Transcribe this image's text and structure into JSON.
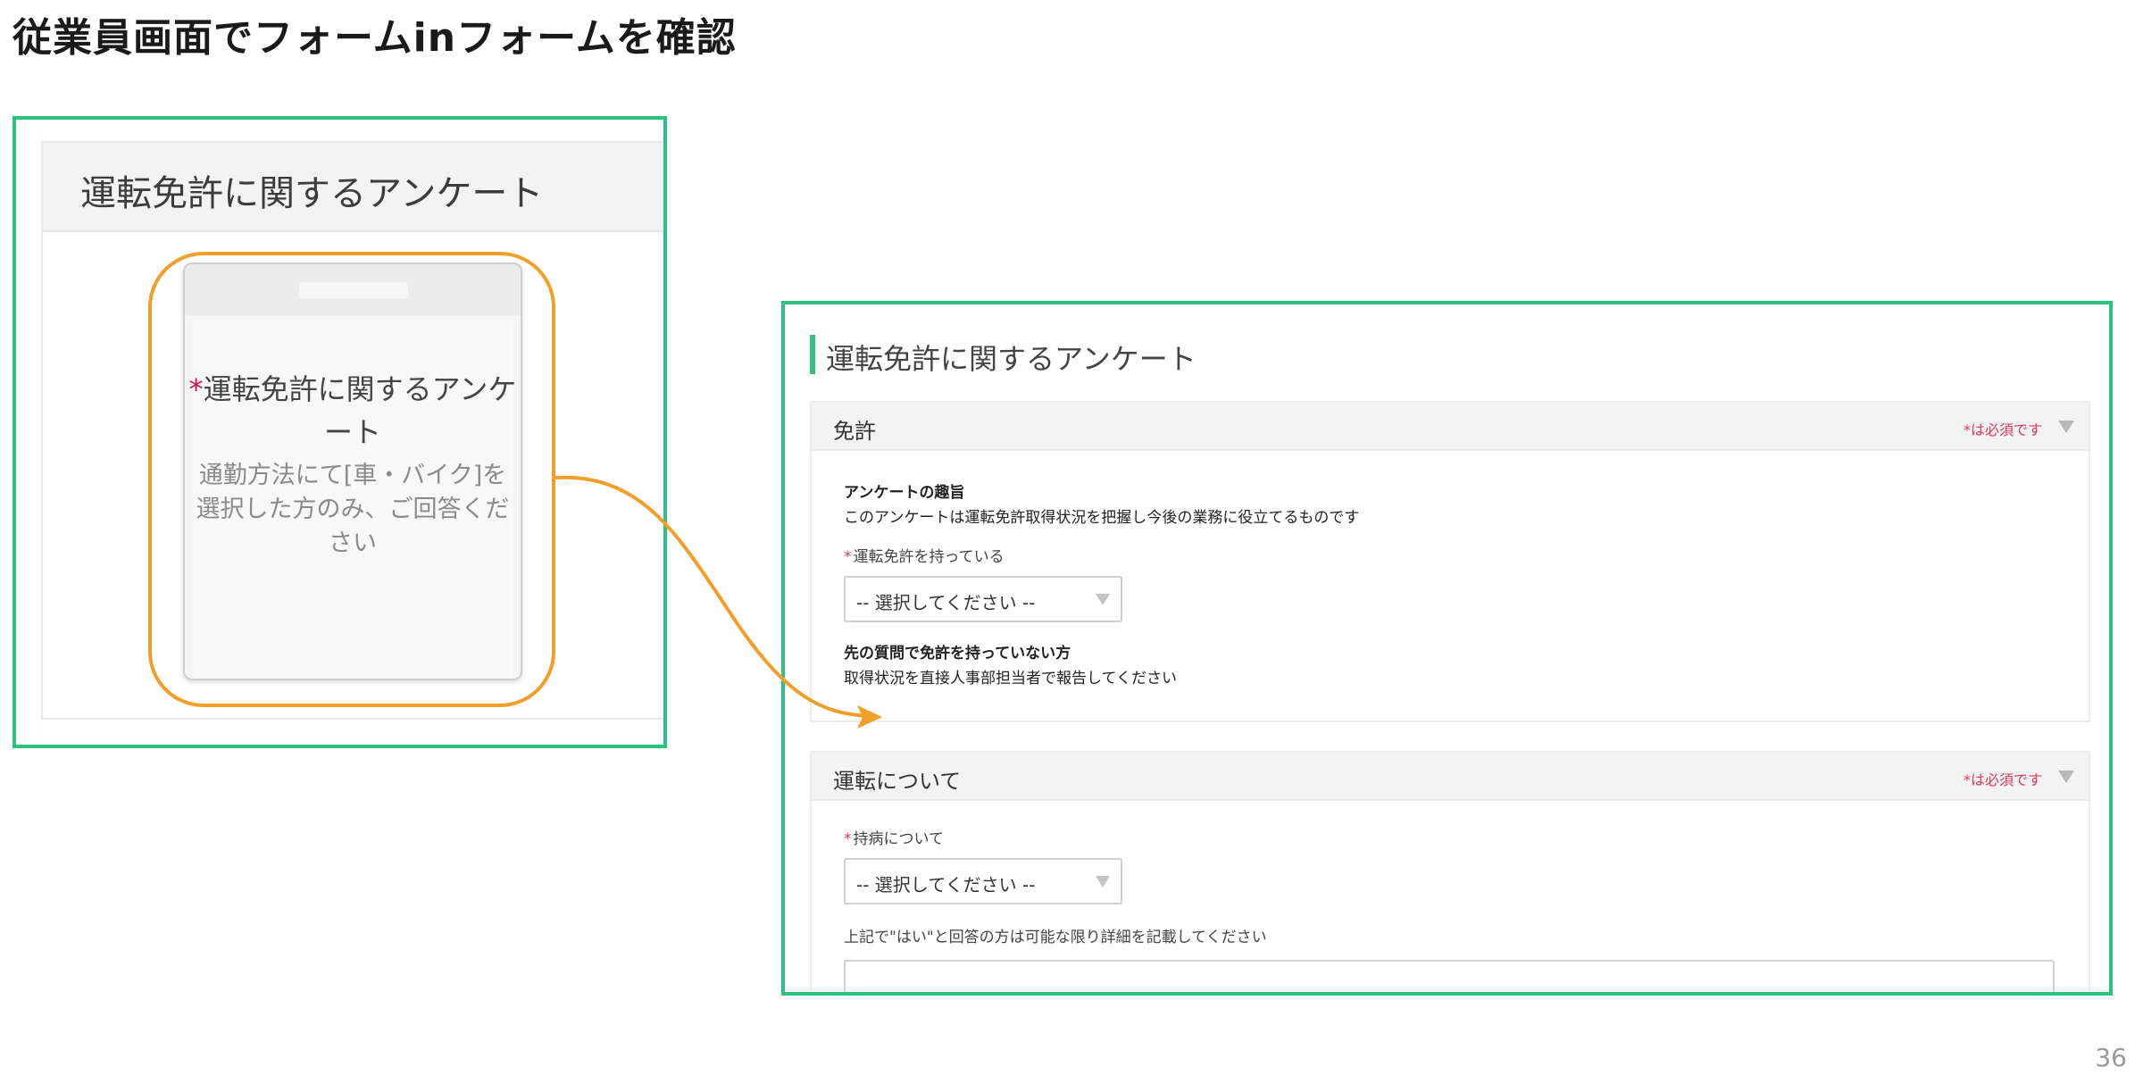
{
  "slide": {
    "title": "従業員画面でフォームinフォームを確認",
    "page_number": "36"
  },
  "left_panel": {
    "header_title": "運転免許に関するアンケート",
    "phone": {
      "required_mark": "*",
      "form_title": "運転免許に関するアンケート",
      "form_description": "通勤方法にて[車・バイク]を選択した方のみ、ご回答ください"
    }
  },
  "right_panel": {
    "title": "運転免許に関するアンケート",
    "sections": [
      {
        "title": "免許",
        "required_note": "*は必須です",
        "intro_heading": "アンケートの趣旨",
        "intro_text": "このアンケートは運転免許取得状況を把握し今後の業務に役立てるものです",
        "field_label": "運転免許を持っている",
        "select_value": "-- 選択してください --",
        "note_heading": "先の質問で免許を持っていない方",
        "note_text": "取得状況を直接人事部担当者で報告してください"
      },
      {
        "title": "運転について",
        "required_note": "*は必須です",
        "field_label": "持病について",
        "select_value": "-- 選択してください --",
        "detail_label": "上記で\"はい\"と回答の方は可能な限り詳細を記載してください",
        "detail_value": ""
      }
    ]
  },
  "colors": {
    "highlight_green": "#2ec27e",
    "highlight_orange": "#f0a02a",
    "required_red": "#e03a58"
  },
  "icons": {
    "section_toggle": "triangle-down",
    "select_arrow": "triangle-down",
    "connector": "curved-arrow"
  }
}
